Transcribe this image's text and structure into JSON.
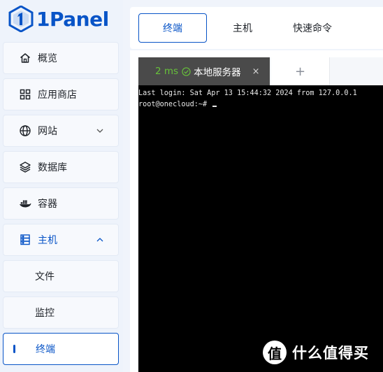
{
  "brand": {
    "name": "1Panel",
    "color": "#0854c7"
  },
  "sidebar": {
    "items": [
      {
        "label": "概览",
        "icon": "home-icon"
      },
      {
        "label": "应用商店",
        "icon": "grid-icon"
      },
      {
        "label": "网站",
        "icon": "globe-icon",
        "expandable": true
      },
      {
        "label": "数据库",
        "icon": "layers-icon"
      },
      {
        "label": "容器",
        "icon": "docker-icon"
      },
      {
        "label": "主机",
        "icon": "server-icon",
        "expanded": true
      }
    ],
    "submenu": [
      {
        "label": "文件"
      },
      {
        "label": "监控"
      },
      {
        "label": "终端",
        "active": true
      }
    ]
  },
  "top_tabs": [
    {
      "label": "终端",
      "active": true
    },
    {
      "label": "主机"
    },
    {
      "label": "快速命令"
    }
  ],
  "session": {
    "ping": "2 ms",
    "name": "本地服务器",
    "close_symbol": "×",
    "add_symbol": "+"
  },
  "terminal": {
    "line1": "Last login: Sat Apr 13 15:44:32 2024 from 127.0.0.1",
    "prompt": "root@onecloud:~#"
  },
  "watermark": {
    "symbol": "值",
    "text": "什么值得买"
  }
}
